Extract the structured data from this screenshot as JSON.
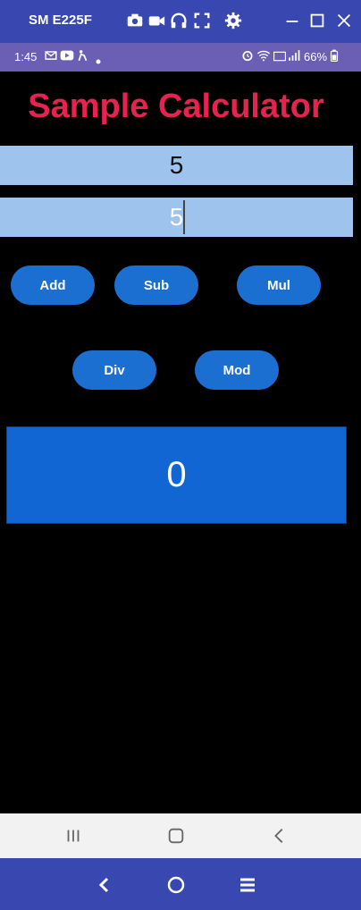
{
  "window": {
    "title": "SM E225F",
    "icons": [
      "camera-icon",
      "video-icon",
      "headset-icon",
      "fullscreen-icon",
      "gear-icon",
      "minimize-icon",
      "maximize-icon",
      "close-icon"
    ]
  },
  "status_bar": {
    "time": "1:45",
    "battery": "66%",
    "icons": [
      "gmail-icon",
      "youtube-icon",
      "accessibility-icon",
      "dot-icon",
      "alarm-icon",
      "wifi-icon",
      "volte-icon",
      "signal-icon",
      "battery-icon"
    ]
  },
  "app": {
    "title": "Sample Calculator",
    "input1_value": "5",
    "input2_value": "5",
    "buttons": {
      "add": "Add",
      "sub": "Sub",
      "mul": "Mul",
      "div": "Div",
      "mod": "Mod"
    },
    "result": "0",
    "colors": {
      "title": "#e8224e",
      "button": "#1b6fd0",
      "input_bg": "#9ec3ec",
      "result_bg": "#1266d4"
    }
  },
  "android_nav": {
    "icons": [
      "recents-icon",
      "home-icon",
      "back-icon"
    ]
  },
  "host_nav": {
    "icons": [
      "back-icon",
      "home-icon",
      "menu-icon"
    ]
  }
}
